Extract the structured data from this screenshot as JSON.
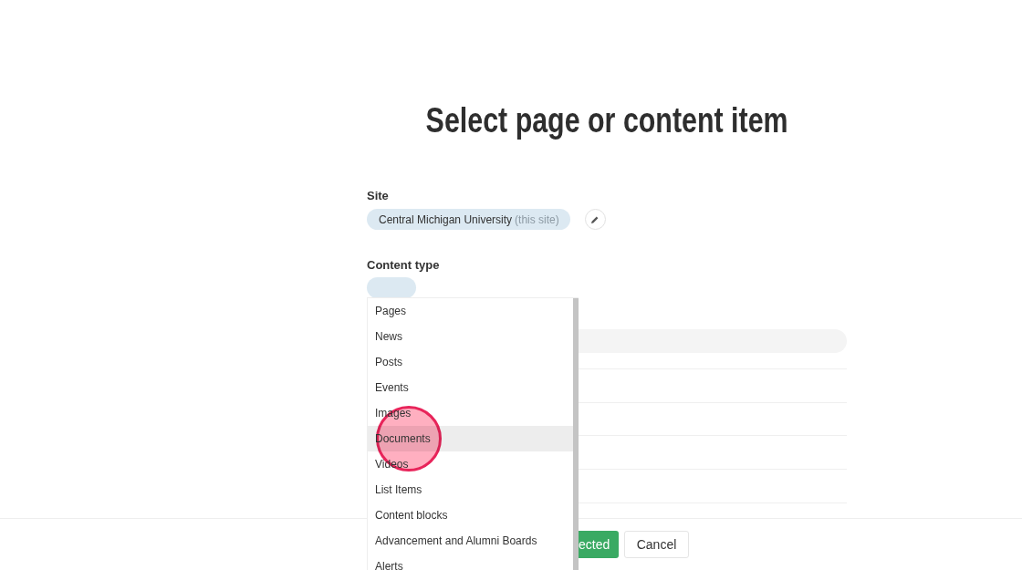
{
  "title": "Select page or content item",
  "site": {
    "label": "Site",
    "value": "Central Michigan University",
    "note": "(this site)"
  },
  "content_type": {
    "label": "Content type",
    "options": [
      {
        "label": "Pages",
        "selected": false
      },
      {
        "label": "News",
        "selected": false
      },
      {
        "label": "Posts",
        "selected": false
      },
      {
        "label": "Events",
        "selected": false
      },
      {
        "label": "Images",
        "selected": false
      },
      {
        "label": "Documents",
        "selected": true
      },
      {
        "label": "Videos",
        "selected": false
      },
      {
        "label": "List Items",
        "selected": false
      },
      {
        "label": "Content blocks",
        "selected": false
      },
      {
        "label": "Advancement and Alumni Boards",
        "selected": false
      },
      {
        "label": "Alerts",
        "selected": false
      }
    ]
  },
  "footer": {
    "buttons": [
      {
        "label": "ected",
        "kind": "primary"
      },
      {
        "label": "Cancel",
        "kind": "secondary"
      }
    ]
  }
}
